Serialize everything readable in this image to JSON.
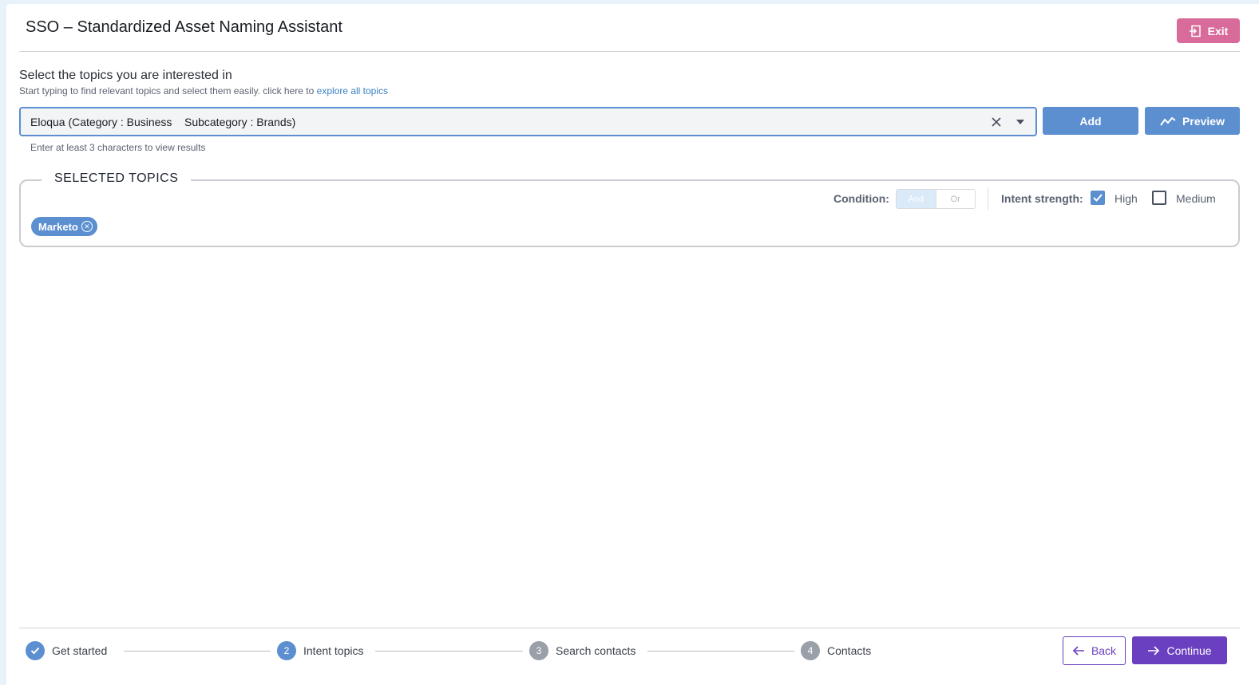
{
  "header": {
    "title": "SSO – Standardized Asset Naming Assistant",
    "exit_label": "Exit"
  },
  "topics_section": {
    "heading": "Select the topics you are interested in",
    "hint": "Start typing to find relevant topics and select them easily. click here to ",
    "hint_link": "explore all topics",
    "search_value": "Eloqua (Category : Business    Subcategory : Brands)",
    "helper": "Enter at least 3 characters to view results",
    "add_label": "Add",
    "preview_label": "Preview"
  },
  "selected_topics": {
    "legend": "SELECTED TOPICS",
    "condition_label": "Condition:",
    "condition_options": [
      "And",
      "Or"
    ],
    "condition_selected": "And",
    "intent_label": "Intent strength:",
    "intent_options": [
      {
        "label": "High",
        "checked": true
      },
      {
        "label": "Medium",
        "checked": false
      }
    ],
    "chips": [
      "Marketo"
    ]
  },
  "stepper": {
    "steps": [
      {
        "number": "",
        "label": "Get started",
        "state": "done"
      },
      {
        "number": "2",
        "label": "Intent topics",
        "state": "active"
      },
      {
        "number": "3",
        "label": "Search contacts",
        "state": "todo"
      },
      {
        "number": "4",
        "label": "Contacts",
        "state": "todo"
      }
    ]
  },
  "footer": {
    "back_label": "Back",
    "continue_label": "Continue"
  },
  "colors": {
    "primary_blue": "#5b8fd0",
    "exit_pink": "#d96b9a",
    "purple": "#6a3fc0"
  }
}
